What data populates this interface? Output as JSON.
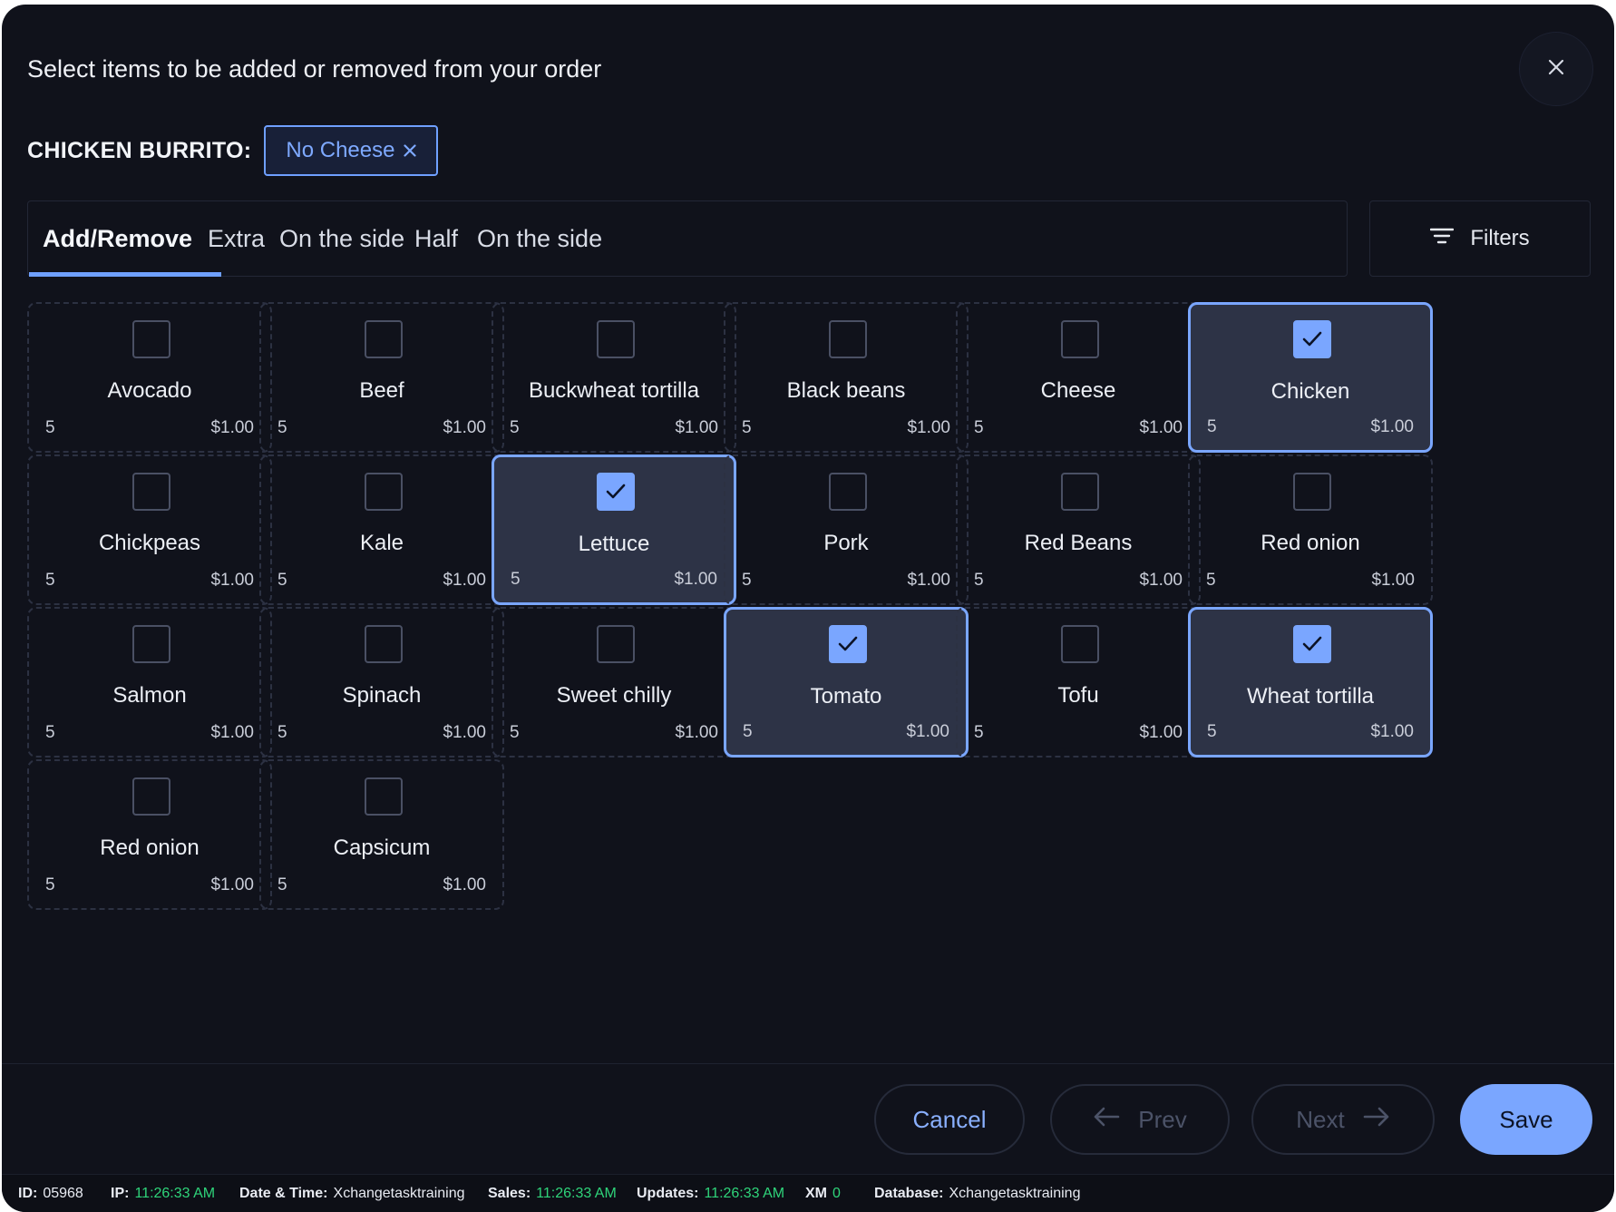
{
  "dialog": {
    "title": "Select items to be added or removed from your order",
    "close_icon": "close-icon"
  },
  "order_item": {
    "name": "CHICKEN BURRITO:",
    "modifiers": [
      {
        "label": "No Cheese",
        "remove_icon": "x-icon"
      }
    ]
  },
  "tabs": [
    {
      "label": "Add/Remove",
      "active": true
    },
    {
      "label": "Extra",
      "active": false
    },
    {
      "label": "On the side",
      "active": false
    },
    {
      "label": "Half",
      "active": false
    },
    {
      "label": "On the side",
      "active": false
    }
  ],
  "filters": {
    "label": "Filters",
    "icon": "filter-icon"
  },
  "ingredients": [
    {
      "name": "Avocado",
      "qty": "5",
      "price": "$1.00",
      "selected": false
    },
    {
      "name": "Beef",
      "qty": "5",
      "price": "$1.00",
      "selected": false
    },
    {
      "name": "Buckwheat tortilla",
      "qty": "5",
      "price": "$1.00",
      "selected": false
    },
    {
      "name": "Black beans",
      "qty": "5",
      "price": "$1.00",
      "selected": false
    },
    {
      "name": "Cheese",
      "qty": "5",
      "price": "$1.00",
      "selected": false
    },
    {
      "name": "Chicken",
      "qty": "5",
      "price": "$1.00",
      "selected": true
    },
    {
      "name": "Chickpeas",
      "qty": "5",
      "price": "$1.00",
      "selected": false
    },
    {
      "name": "Kale",
      "qty": "5",
      "price": "$1.00",
      "selected": false
    },
    {
      "name": "Lettuce",
      "qty": "5",
      "price": "$1.00",
      "selected": true
    },
    {
      "name": "Pork",
      "qty": "5",
      "price": "$1.00",
      "selected": false
    },
    {
      "name": "Red Beans",
      "qty": "5",
      "price": "$1.00",
      "selected": false
    },
    {
      "name": "Red onion",
      "qty": "5",
      "price": "$1.00",
      "selected": false
    },
    {
      "name": "Salmon",
      "qty": "5",
      "price": "$1.00",
      "selected": false
    },
    {
      "name": "Spinach",
      "qty": "5",
      "price": "$1.00",
      "selected": false
    },
    {
      "name": "Sweet chilly",
      "qty": "5",
      "price": "$1.00",
      "selected": false
    },
    {
      "name": "Tomato",
      "qty": "5",
      "price": "$1.00",
      "selected": true
    },
    {
      "name": "Tofu",
      "qty": "5",
      "price": "$1.00",
      "selected": false
    },
    {
      "name": "Wheat tortilla",
      "qty": "5",
      "price": "$1.00",
      "selected": true
    },
    {
      "name": "Red onion",
      "qty": "5",
      "price": "$1.00",
      "selected": false
    },
    {
      "name": "Capsicum",
      "qty": "5",
      "price": "$1.00",
      "selected": false
    }
  ],
  "actions": {
    "cancel": "Cancel",
    "prev": "Prev",
    "next": "Next",
    "save": "Save"
  },
  "status_bar": {
    "id_label": "ID:",
    "id_value": "05968",
    "ip_label": "IP:",
    "ip_value": "11:26:33 AM",
    "datetime_label": "Date & Time:",
    "datetime_value": "Xchangetasktraining",
    "sales_label": "Sales:",
    "sales_value": "11:26:33 AM",
    "updates_label": "Updates:",
    "updates_value": "11:26:33 AM",
    "xm_label": "XM",
    "xm_value": "0",
    "database_label": "Database:",
    "database_value": "Xchangetasktraining"
  },
  "colors": {
    "accent": "#7aa6ff",
    "background": "#10121b",
    "selected_card": "#2d3346",
    "status_green": "#2fd47a"
  }
}
